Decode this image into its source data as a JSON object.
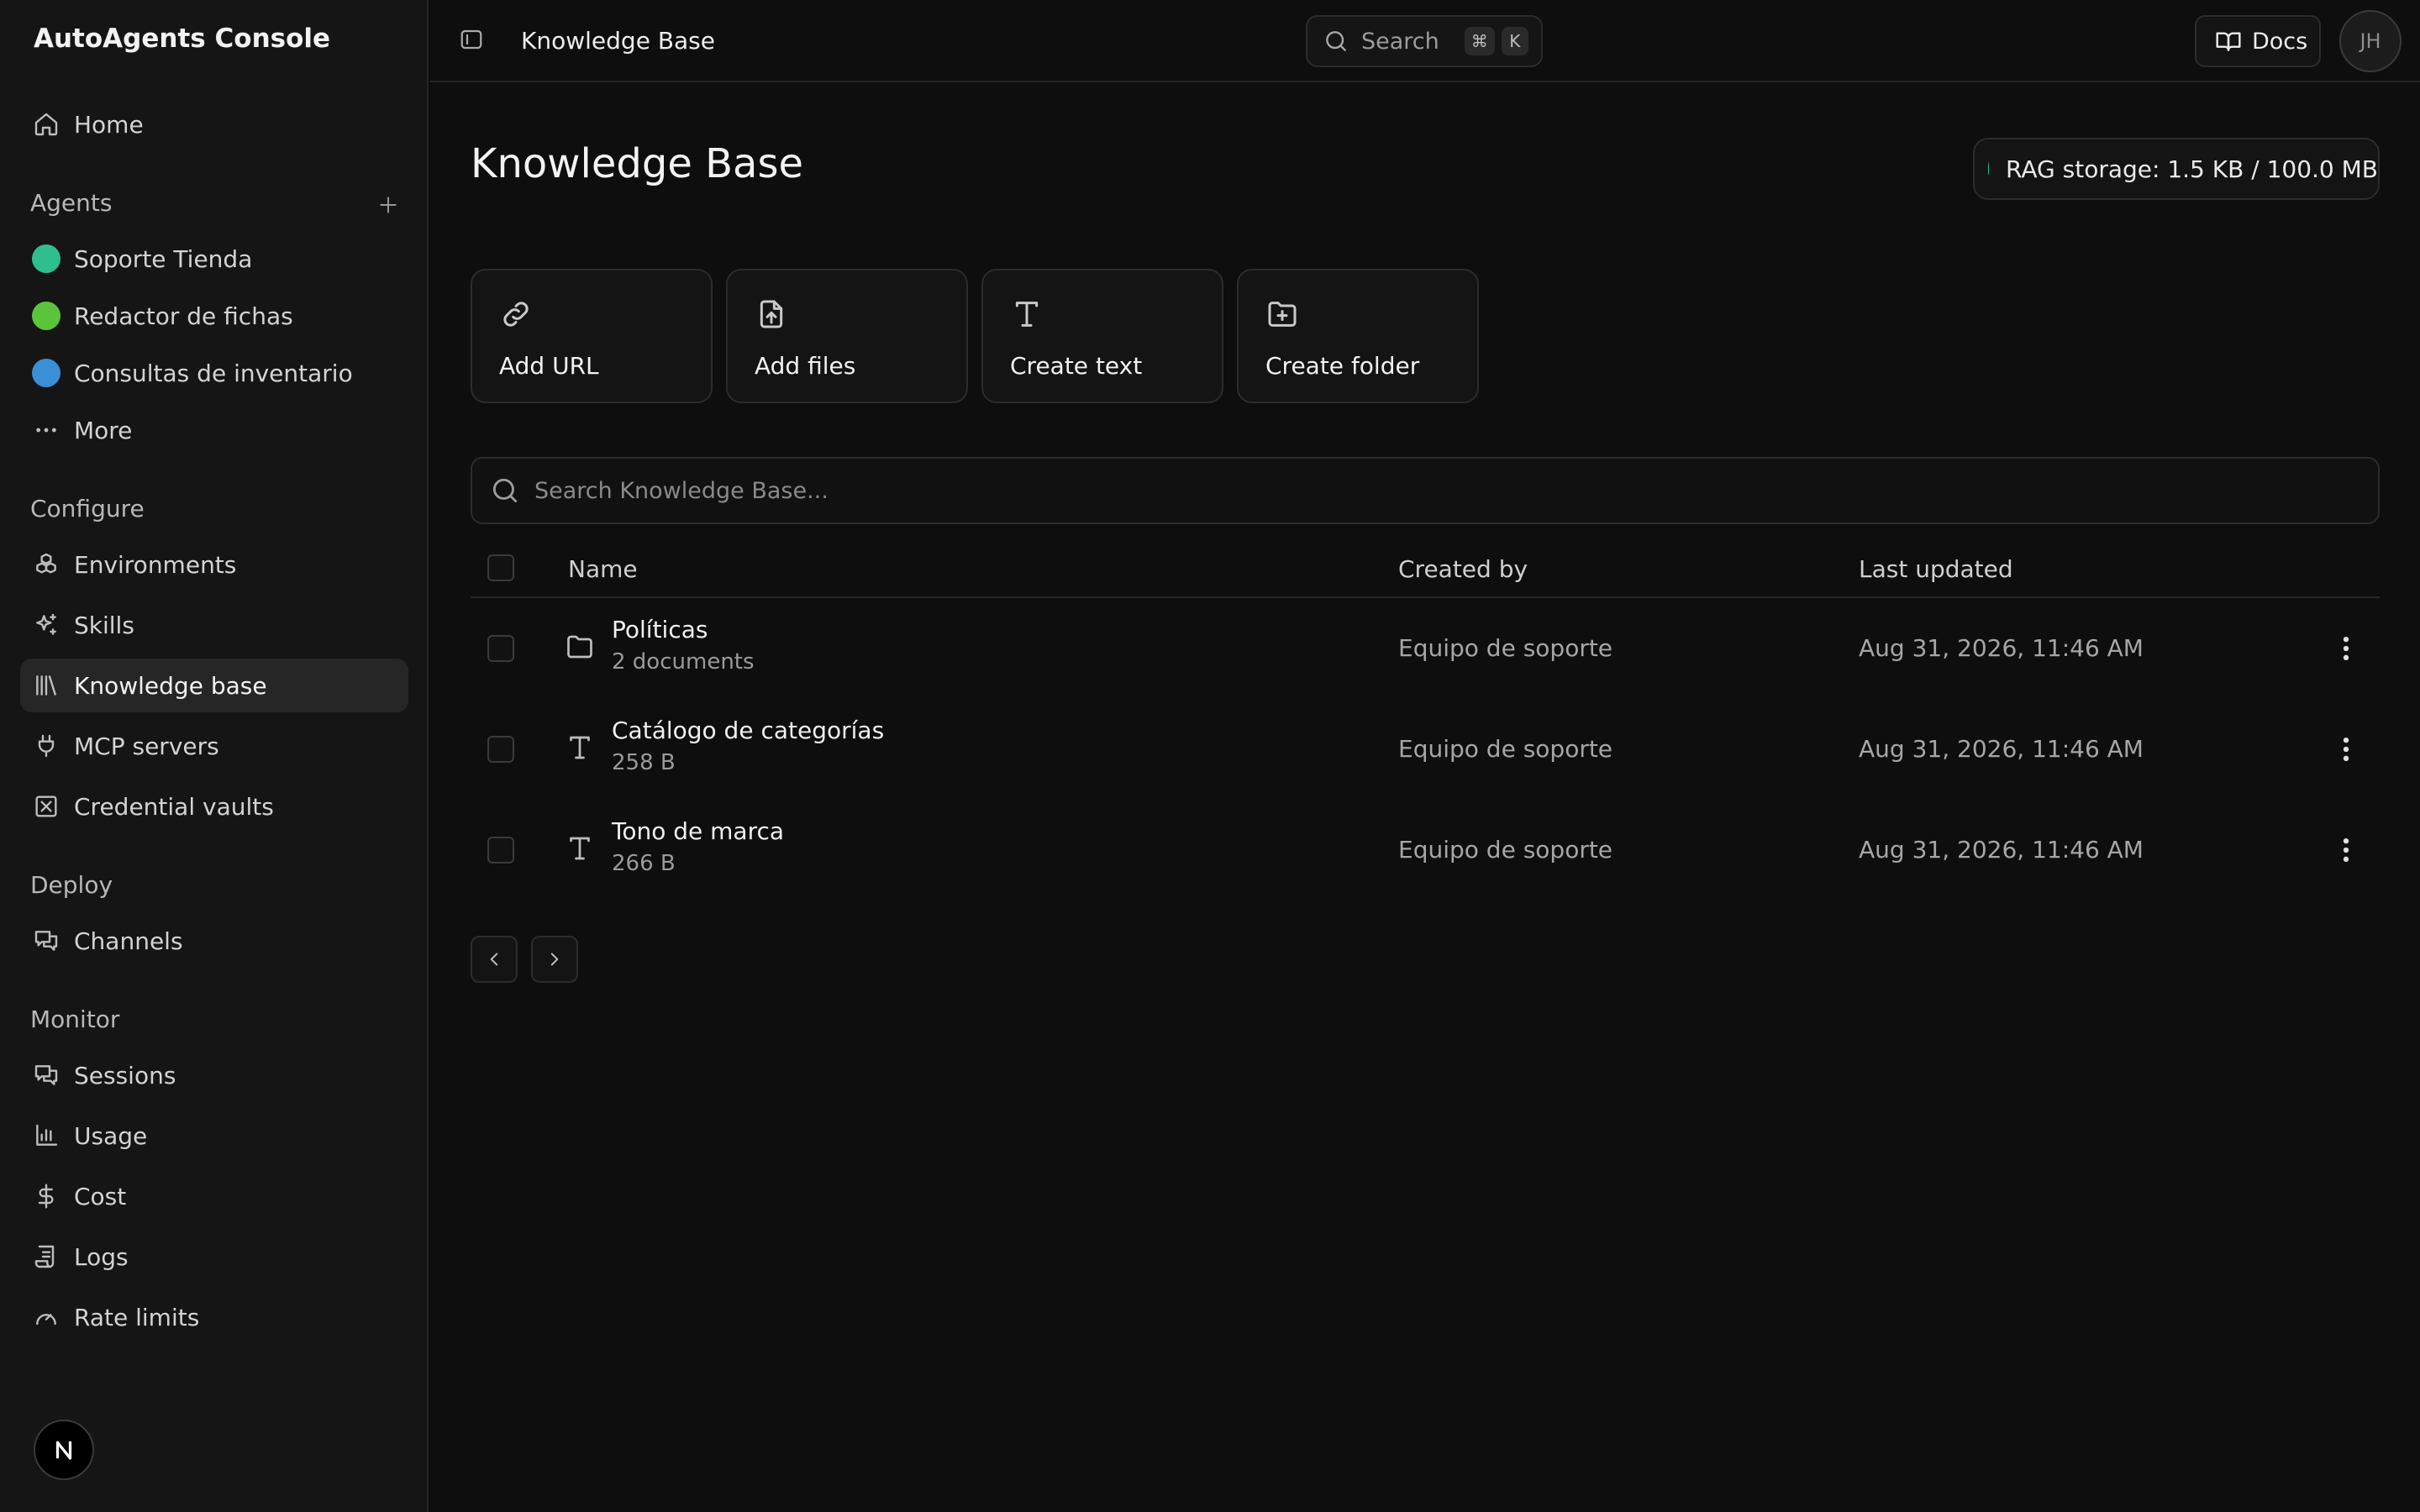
{
  "app": {
    "title": "AutoAgents Console"
  },
  "sidebar": {
    "home": {
      "label": "Home",
      "icon": "home-icon"
    },
    "agents_section": {
      "label": "Agents"
    },
    "agents": [
      {
        "label": "Soporte Tienda",
        "color": "#2fbf8f"
      },
      {
        "label": "Redactor de fichas",
        "color": "#5cc43a"
      },
      {
        "label": "Consultas de inventario",
        "color": "#3a8fd6"
      }
    ],
    "more": {
      "label": "More"
    },
    "configure_section": {
      "label": "Configure"
    },
    "configure": [
      {
        "label": "Environments",
        "icon": "boxes-icon"
      },
      {
        "label": "Skills",
        "icon": "sparkles-icon"
      },
      {
        "label": "Knowledge base",
        "icon": "library-icon",
        "active": true
      },
      {
        "label": "MCP servers",
        "icon": "plug-icon"
      },
      {
        "label": "Credential vaults",
        "icon": "vault-icon"
      }
    ],
    "deploy_section": {
      "label": "Deploy"
    },
    "deploy": [
      {
        "label": "Channels",
        "icon": "chat-icon"
      }
    ],
    "monitor_section": {
      "label": "Monitor"
    },
    "monitor": [
      {
        "label": "Sessions",
        "icon": "chat-icon"
      },
      {
        "label": "Usage",
        "icon": "bar-chart-icon"
      },
      {
        "label": "Cost",
        "icon": "dollar-icon"
      },
      {
        "label": "Logs",
        "icon": "scroll-icon"
      },
      {
        "label": "Rate limits",
        "icon": "gauge-icon"
      }
    ]
  },
  "topbar": {
    "breadcrumb": "Knowledge Base",
    "search": {
      "label": "Search",
      "kbd1": "⌘",
      "kbd2": "K"
    },
    "docs_label": "Docs",
    "avatar_initials": "JH"
  },
  "main": {
    "title": "Knowledge Base",
    "storage": {
      "label": "RAG storage: 1.5 KB / 100.0 MB",
      "status_color": "#22c38e"
    },
    "actions": [
      {
        "label": "Add URL",
        "icon": "link-icon"
      },
      {
        "label": "Add files",
        "icon": "file-upload-icon"
      },
      {
        "label": "Create text",
        "icon": "text-icon"
      },
      {
        "label": "Create folder",
        "icon": "folder-plus-icon"
      }
    ],
    "search_placeholder": "Search Knowledge Base...",
    "table": {
      "columns": {
        "name": "Name",
        "created_by": "Created by",
        "last_updated": "Last updated"
      },
      "rows": [
        {
          "name": "Políticas",
          "sub": "2 documents",
          "type": "folder",
          "created_by": "Equipo de soporte",
          "last_updated": "Aug 31, 2026, 11:46 AM"
        },
        {
          "name": "Catálogo de categorías",
          "sub": "258 B",
          "type": "text",
          "created_by": "Equipo de soporte",
          "last_updated": "Aug 31, 2026, 11:46 AM"
        },
        {
          "name": "Tono de marca",
          "sub": "266 B",
          "type": "text",
          "created_by": "Equipo de soporte",
          "last_updated": "Aug 31, 2026, 11:46 AM"
        }
      ]
    }
  }
}
